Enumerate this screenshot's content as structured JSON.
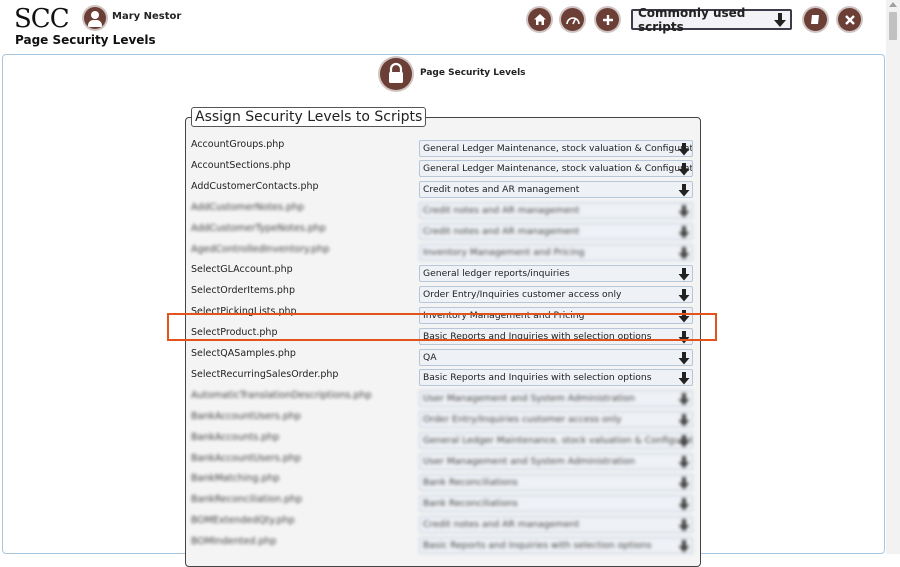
{
  "header": {
    "logo": "SCC",
    "user_name": "Mary Nestor",
    "page_heading": "Page Security Levels",
    "scripts_menu_label": "Commonly used scripts",
    "icons": [
      "home-icon",
      "dashboard-icon",
      "plus-icon",
      "manual-icon",
      "close-icon"
    ]
  },
  "main": {
    "section_icon": "lock-icon",
    "section_title": "Page Security Levels",
    "legend": "Assign Security Levels to Scripts",
    "rows": [
      {
        "script": "AccountGroups.php",
        "level": "General Ledger Maintenance, stock valuation & Configuration",
        "blurred": false
      },
      {
        "script": "AccountSections.php",
        "level": "General Ledger Maintenance, stock valuation & Configuration",
        "blurred": false
      },
      {
        "script": "AddCustomerContacts.php",
        "level": "Credit notes and AR management",
        "blurred": false
      },
      {
        "script": "AddCustomerNotes.php",
        "level": "Credit notes and AR management",
        "blurred": true
      },
      {
        "script": "AddCustomerTypeNotes.php",
        "level": "Credit notes and AR management",
        "blurred": true
      },
      {
        "script": "AgedControlledInventory.php",
        "level": "Inventory Management and Pricing",
        "blurred": true
      },
      {
        "script": "SelectGLAccount.php",
        "level": "General ledger reports/inquiries",
        "blurred": false
      },
      {
        "script": "SelectOrderItems.php",
        "level": "Order Entry/Inquiries customer access only",
        "blurred": false
      },
      {
        "script": "SelectPickingLists.php",
        "level": "Inventory Management and Pricing",
        "blurred": false
      },
      {
        "script": "SelectProduct.php",
        "level": "Basic Reports and Inquiries with selection options",
        "blurred": false,
        "highlighted": true
      },
      {
        "script": "SelectQASamples.php",
        "level": "QA",
        "blurred": false
      },
      {
        "script": "SelectRecurringSalesOrder.php",
        "level": "Basic Reports and Inquiries with selection options",
        "blurred": false
      },
      {
        "script": "AutomaticTranslationDescriptions.php",
        "level": "User Management and System Administration",
        "blurred": true
      },
      {
        "script": "BankAccountUsers.php",
        "level": "Order Entry/Inquiries customer access only",
        "blurred": true
      },
      {
        "script": "BankAccounts.php",
        "level": "General Ledger Maintenance, stock valuation & Configuration",
        "blurred": true
      },
      {
        "script": "BankAccountUsers.php",
        "level": "User Management and System Administration",
        "blurred": true
      },
      {
        "script": "BankMatching.php",
        "level": "Bank Reconciliations",
        "blurred": true
      },
      {
        "script": "BankReconciliation.php",
        "level": "Bank Reconciliations",
        "blurred": true
      },
      {
        "script": "BOMExtendedQty.php",
        "level": "Credit notes and AR management",
        "blurred": true
      },
      {
        "script": "BOMIndented.php",
        "level": "Basic Reports and Inquiries with selection options",
        "blurred": true
      }
    ]
  }
}
